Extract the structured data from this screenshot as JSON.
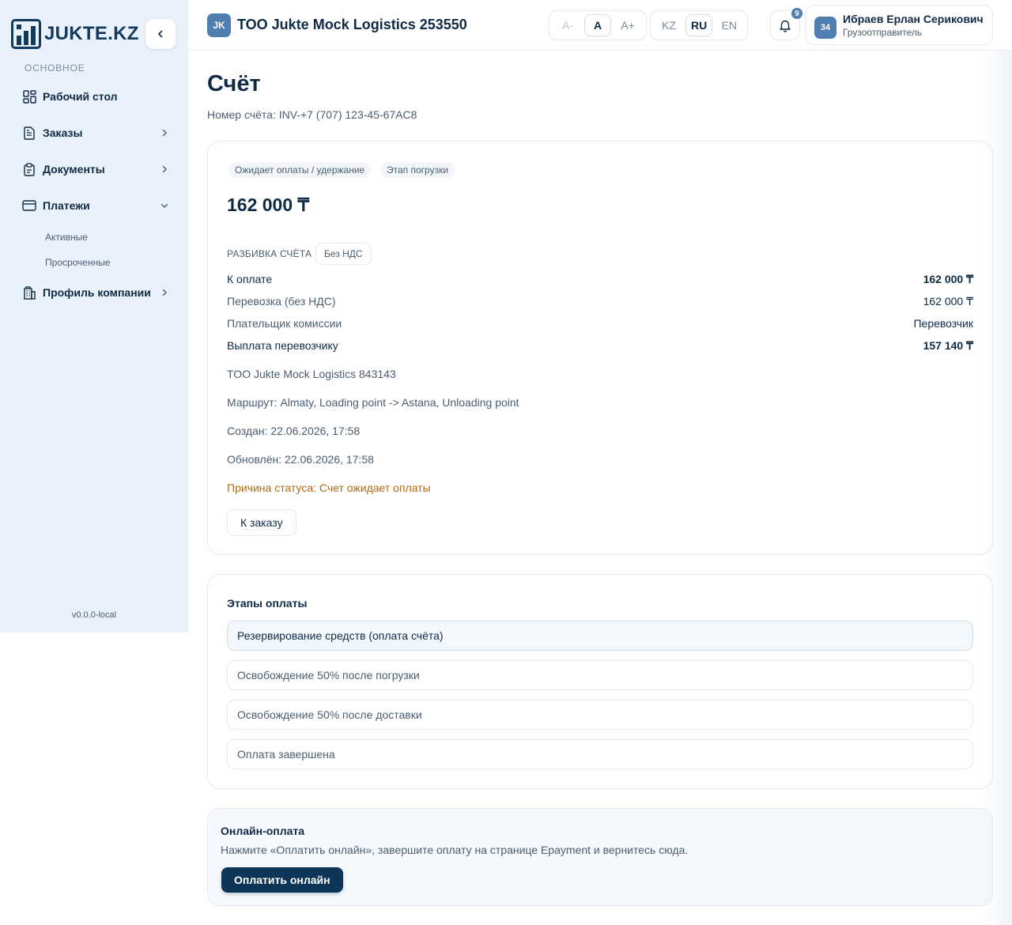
{
  "sidebar": {
    "logo_text": "JUKTE.KZ",
    "section_label": "ОСНОВНОЕ",
    "items": [
      {
        "label": "Рабочий стол"
      },
      {
        "label": "Заказы"
      },
      {
        "label": "Документы"
      },
      {
        "label": "Платежи"
      },
      {
        "label": "Профиль компании"
      }
    ],
    "payments_sub": [
      {
        "label": "Активные"
      },
      {
        "label": "Просроченные"
      }
    ],
    "version": "v0.0.0-local"
  },
  "header": {
    "company_initials": "JK",
    "company_name": "TOO Jukte Mock Logistics 253550",
    "font_sizes": [
      "A-",
      "A",
      "A+"
    ],
    "languages": [
      "KZ",
      "RU",
      "EN"
    ],
    "active_language": "RU",
    "notifications_count": "9",
    "user": {
      "avatar": "34",
      "name": "Ибраев Ерлан Серикович",
      "role": "Грузоотправитель"
    }
  },
  "page": {
    "title": "Счёт",
    "invoice_number": "Номер счёта: INV-+7 (707) 123-45-67AC8"
  },
  "invoice": {
    "chips": [
      "Ожидает оплаты / удержание",
      "Этап погрузки"
    ],
    "amount": "162 000 ₸",
    "breakdown_label": "РАЗБИВКА СЧЁТА",
    "vat_label": "Без НДС",
    "rows": [
      {
        "key": "К оплате",
        "value": "162 000 ₸"
      },
      {
        "key": "Перевозка (без НДС)",
        "value": "162 000 ₸"
      },
      {
        "key": "Плательщик комиссии",
        "value": "Перевозчик"
      },
      {
        "key": "Выплата перевозчику",
        "value": "157 140 ₸"
      }
    ],
    "counterparty": "TOO Jukte Mock Logistics 843143",
    "route": "Маршрут: Almaty, Loading point -> Astana, Unloading point",
    "created": "Создан: 22.06.2026, 17:58",
    "updated": "Обновлён: 22.06.2026, 17:58",
    "status_reason": "Причина статуса: Счет ожидает оплаты",
    "to_order_button": "К заказу"
  },
  "stages": {
    "title": "Этапы оплаты",
    "items": [
      "Резервирование средств (оплата счёта)",
      "Освобождение 50% после погрузки",
      "Освобождение 50% после доставки",
      "Оплата завершена"
    ]
  },
  "online_payment": {
    "title": "Онлайн-оплата",
    "description": "Нажмите «Оплатить онлайн», завершите оплату на странице Epayment и вернитесь сюда.",
    "button": "Оплатить онлайн"
  },
  "colors": {
    "brand": "#123a5e",
    "accent": "#4f7fb0",
    "primary_button": "#0d3557",
    "warning_text": "#b06a12",
    "sidebar_bg": "#e9f1fb"
  }
}
